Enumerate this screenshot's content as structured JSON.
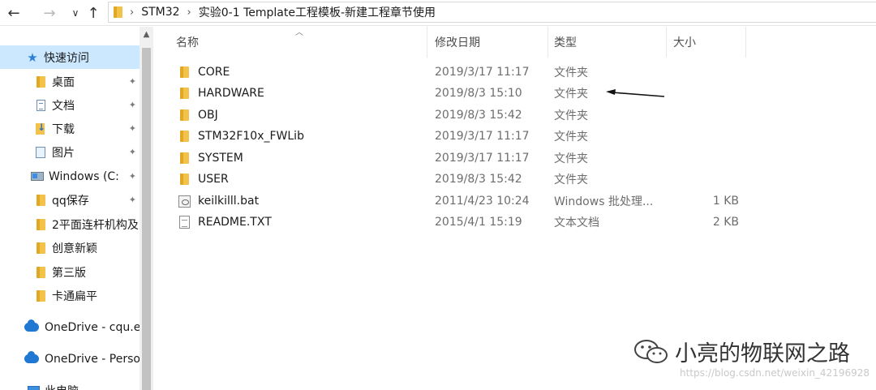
{
  "address": {
    "back": "←",
    "forward": "→",
    "history": "∨",
    "up": "↑",
    "breadcrumbs": [
      "STM32",
      "实验0-1 Template工程模板-新建工程章节使用"
    ]
  },
  "nav": {
    "quick_access": "快速访问",
    "items": [
      {
        "label": "桌面",
        "icon": "desktop-folder-icon",
        "pinned": true
      },
      {
        "label": "文档",
        "icon": "documents-icon",
        "pinned": true
      },
      {
        "label": "下载",
        "icon": "downloads-icon",
        "pinned": true
      },
      {
        "label": "图片",
        "icon": "pictures-icon",
        "pinned": true
      },
      {
        "label": "Windows (C:",
        "icon": "drive-icon",
        "pinned": true
      },
      {
        "label": "qq保存",
        "icon": "folder-icon",
        "pinned": true
      },
      {
        "label": "2平面连杆机构及",
        "icon": "folder-icon",
        "pinned": false
      },
      {
        "label": "创意新颖",
        "icon": "folder-icon",
        "pinned": false
      },
      {
        "label": "第三版",
        "icon": "folder-icon",
        "pinned": false
      },
      {
        "label": "卡通扁平",
        "icon": "folder-icon",
        "pinned": false
      }
    ],
    "onedrive1": "OneDrive - cqu.e",
    "onedrive2": "OneDrive - Perso",
    "this_pc": "此电脑",
    "pin_glyph": "📌"
  },
  "columns": {
    "name": "名称",
    "modified": "修改日期",
    "type": "类型",
    "size": "大小"
  },
  "files": [
    {
      "name": "CORE",
      "modified": "2019/3/17 11:17",
      "type": "文件夹",
      "size": "",
      "icon": "folder-icon"
    },
    {
      "name": "HARDWARE",
      "modified": "2019/8/3 15:10",
      "type": "文件夹",
      "size": "",
      "icon": "folder-icon"
    },
    {
      "name": "OBJ",
      "modified": "2019/8/3 15:42",
      "type": "文件夹",
      "size": "",
      "icon": "folder-icon"
    },
    {
      "name": "STM32F10x_FWLib",
      "modified": "2019/3/17 11:17",
      "type": "文件夹",
      "size": "",
      "icon": "folder-icon"
    },
    {
      "name": "SYSTEM",
      "modified": "2019/3/17 11:17",
      "type": "文件夹",
      "size": "",
      "icon": "folder-icon"
    },
    {
      "name": "USER",
      "modified": "2019/8/3 15:42",
      "type": "文件夹",
      "size": "",
      "icon": "folder-icon"
    },
    {
      "name": "keilkilll.bat",
      "modified": "2011/4/23 10:24",
      "type": "Windows 批处理...",
      "size": "1 KB",
      "icon": "batch-file-icon"
    },
    {
      "name": "README.TXT",
      "modified": "2015/4/1 15:19",
      "type": "文本文档",
      "size": "2 KB",
      "icon": "text-file-icon"
    }
  ],
  "watermark": {
    "text": "小亮的物联网之路",
    "url": "https://blog.csdn.net/weixin_42196928"
  },
  "colors": {
    "selection": "#cce8ff",
    "folder": "#f2c24a",
    "accent": "#2f7fd6"
  }
}
